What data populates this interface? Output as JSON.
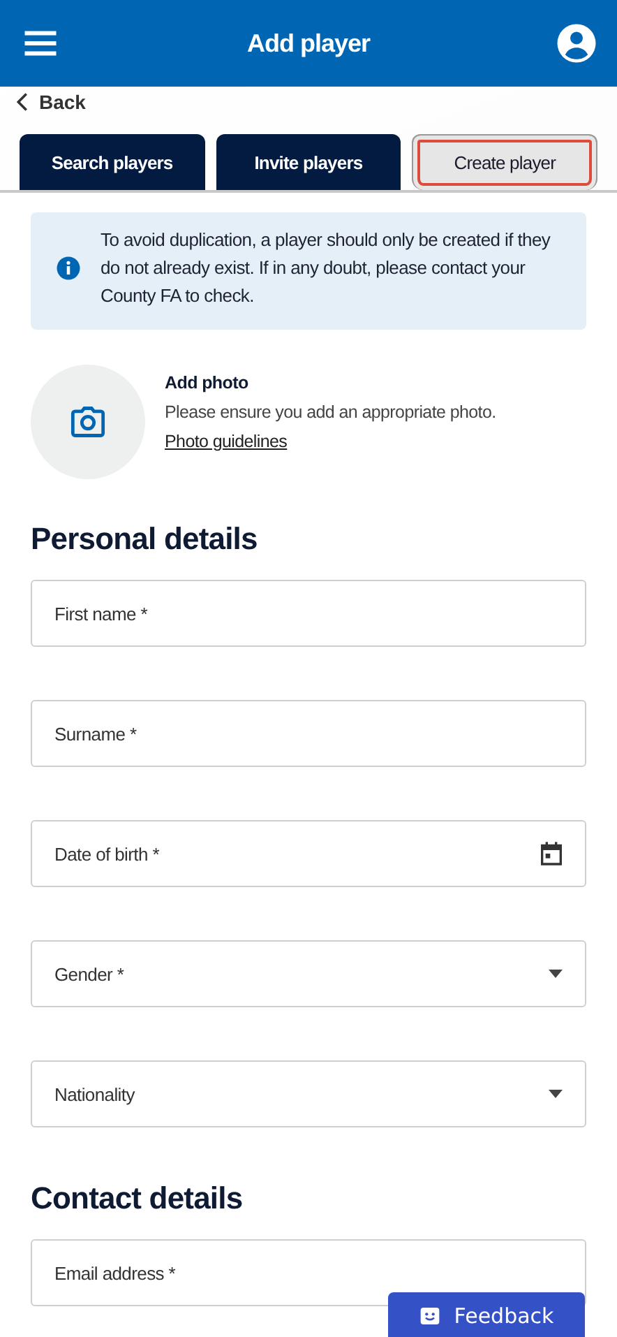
{
  "header": {
    "title": "Add player"
  },
  "back_link": "Back",
  "tabs": [
    {
      "label": "Search players",
      "selected": false
    },
    {
      "label": "Invite players",
      "selected": false
    },
    {
      "label": "Create player",
      "selected": true
    }
  ],
  "notice": "To avoid duplication, a player should only be created if they do not already exist. If in any doubt, please contact your County FA to check.",
  "photo": {
    "title": "Add photo",
    "hint": "Please ensure you add an appropriate photo.",
    "link": "Photo guidelines"
  },
  "sections": [
    {
      "title": "Personal details",
      "fields": [
        {
          "kind": "text",
          "label": "First name *"
        },
        {
          "kind": "text",
          "label": "Surname *"
        },
        {
          "kind": "date",
          "label": "Date of birth *"
        },
        {
          "kind": "select",
          "label": "Gender *"
        },
        {
          "kind": "select",
          "label": "Nationality"
        }
      ]
    },
    {
      "title": "Contact details",
      "fields": [
        {
          "kind": "text",
          "label": "Email address *"
        }
      ]
    }
  ],
  "feedback_button": "Feedback"
}
